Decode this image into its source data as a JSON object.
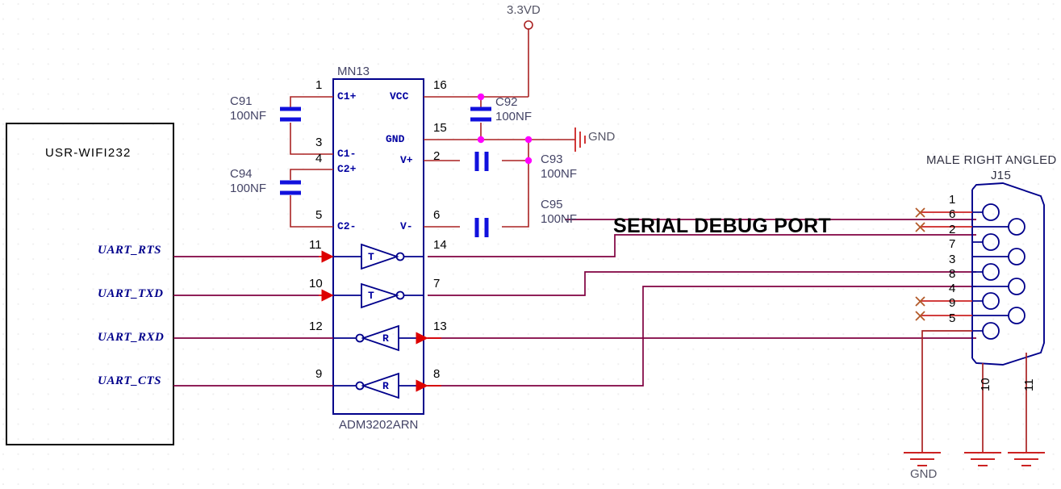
{
  "sheet": {
    "title": "SERIAL DEBUG PORT",
    "background": "#ffffff",
    "colors": {
      "wire": "#800040",
      "pin_wire": "#cc0000",
      "symbol": "#00008B",
      "junction": "#ff00ff",
      "grid_dot": "#efefef"
    }
  },
  "module_block": {
    "name": "USR-WIFI232",
    "pins": [
      {
        "label": "UART_RTS"
      },
      {
        "label": "UART_TXD"
      },
      {
        "label": "UART_RXD"
      },
      {
        "label": "UART_CTS"
      }
    ]
  },
  "ic": {
    "refdes": "MN13",
    "part": "ADM3202ARN",
    "left_pins": [
      {
        "num": "1",
        "name": "C1+"
      },
      {
        "num": "3",
        "name": "C1-"
      },
      {
        "num": "4",
        "name": "C2+"
      },
      {
        "num": "5",
        "name": "C2-"
      },
      {
        "num": "11",
        "name": ""
      },
      {
        "num": "10",
        "name": ""
      },
      {
        "num": "12",
        "name": ""
      },
      {
        "num": "9",
        "name": ""
      }
    ],
    "right_pins": [
      {
        "num": "16",
        "name": "VCC"
      },
      {
        "num": "15",
        "name": "GND"
      },
      {
        "num": "2",
        "name": "V+"
      },
      {
        "num": "6",
        "name": "V-"
      },
      {
        "num": "14",
        "name": ""
      },
      {
        "num": "7",
        "name": ""
      },
      {
        "num": "13",
        "name": ""
      },
      {
        "num": "8",
        "name": ""
      }
    ],
    "buffers": [
      {
        "type": "T",
        "in_pin": "11",
        "out_pin": "14"
      },
      {
        "type": "T",
        "in_pin": "10",
        "out_pin": "7"
      },
      {
        "type": "R",
        "out_pin": "12",
        "in_pin": "13"
      },
      {
        "type": "R",
        "out_pin": "9",
        "in_pin": "8"
      }
    ]
  },
  "capacitors": [
    {
      "refdes": "C91",
      "value": "100NF",
      "style": "horizontal-plates"
    },
    {
      "refdes": "C94",
      "value": "100NF",
      "style": "horizontal-plates"
    },
    {
      "refdes": "C92",
      "value": "100NF",
      "style": "horizontal-plates"
    },
    {
      "refdes": "C93",
      "value": "100NF",
      "style": "vertical-plates"
    },
    {
      "refdes": "C95",
      "value": "100NF",
      "style": "vertical-plates"
    }
  ],
  "power": {
    "rail_label": "3.3VD",
    "gnd_label_ic": "GND",
    "gnd_label_connector": "GND"
  },
  "connector": {
    "description": "MALE RIGHT ANGLED",
    "refdes": "J15",
    "pins": [
      {
        "num": "1",
        "connected": false
      },
      {
        "num": "6",
        "connected": false
      },
      {
        "num": "2",
        "connected": true
      },
      {
        "num": "7",
        "connected": true
      },
      {
        "num": "3",
        "connected": true
      },
      {
        "num": "8",
        "connected": true
      },
      {
        "num": "4",
        "connected": false
      },
      {
        "num": "9",
        "connected": false
      },
      {
        "num": "5",
        "connected": true
      }
    ],
    "shell_pins": [
      {
        "num": "10"
      },
      {
        "num": "11"
      }
    ]
  }
}
